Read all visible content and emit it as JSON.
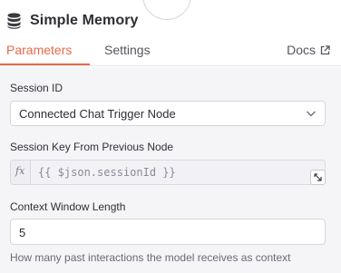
{
  "header": {
    "title": "Simple Memory",
    "node_icon": "database-icon"
  },
  "tabs": {
    "parameters": "Parameters",
    "settings": "Settings",
    "docs": "Docs"
  },
  "accent_color": "#e8694a",
  "fields": {
    "session_id": {
      "label": "Session ID",
      "value": "Connected Chat Trigger Node"
    },
    "session_key": {
      "label": "Session Key From Previous Node",
      "fx": "fx",
      "value": "{{ $json.sessionId }}"
    },
    "context_window": {
      "label": "Context Window Length",
      "value": "5",
      "hint": "How many past interactions the model receives as context"
    }
  }
}
